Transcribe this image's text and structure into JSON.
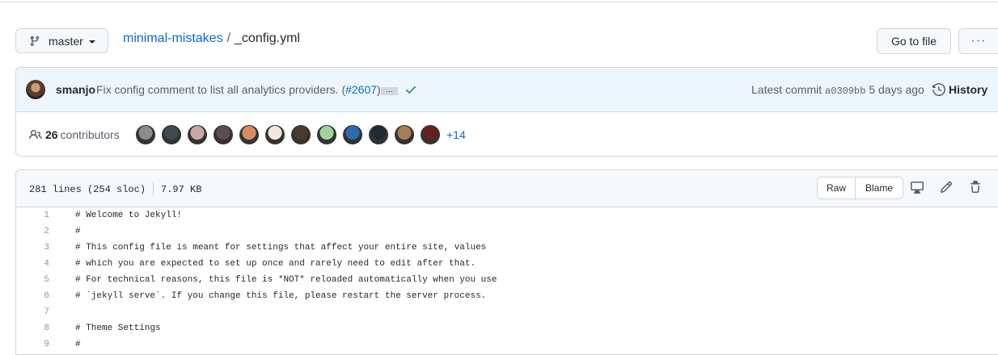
{
  "branch": {
    "name": "master"
  },
  "breadcrumb": {
    "repo": "minimal-mistakes",
    "separator": "/",
    "file": "_config.yml"
  },
  "actions": {
    "goto_file": "Go to file",
    "more": "···"
  },
  "commit": {
    "author": "smanjo",
    "message": "Fix config comment to list all analytics providers. (",
    "pr": "#2607",
    "message_end": ")",
    "ellipsis": "…",
    "latest_label": "Latest commit",
    "sha": "a0309bb",
    "age": "5 days ago",
    "history": "History"
  },
  "contributors": {
    "count": "26",
    "label": "contributors",
    "more": "+14",
    "avatar_colors": [
      "#8b8b8b",
      "#3f4a52",
      "#c9a8a4",
      "#5a4d56",
      "#d98c5f",
      "#f2e7da",
      "#4b3a2f",
      "#9ed49a",
      "#2b6cb0",
      "#1e2a36",
      "#a87d54",
      "#6b1f1f"
    ]
  },
  "file": {
    "lines_info": "281 lines (254 sloc)",
    "size": "7.97 KB",
    "raw": "Raw",
    "blame": "Blame"
  },
  "code": [
    {
      "n": "1",
      "t": "# Welcome to Jekyll!"
    },
    {
      "n": "2",
      "t": "#"
    },
    {
      "n": "3",
      "t": "# This config file is meant for settings that affect your entire site, values"
    },
    {
      "n": "4",
      "t": "# which you are expected to set up once and rarely need to edit after that."
    },
    {
      "n": "5",
      "t": "# For technical reasons, this file is *NOT* reloaded automatically when you use"
    },
    {
      "n": "6",
      "t": "# `jekyll serve`. If you change this file, please restart the server process."
    },
    {
      "n": "7",
      "t": ""
    },
    {
      "n": "8",
      "t": "# Theme Settings"
    },
    {
      "n": "9",
      "t": "#"
    }
  ]
}
